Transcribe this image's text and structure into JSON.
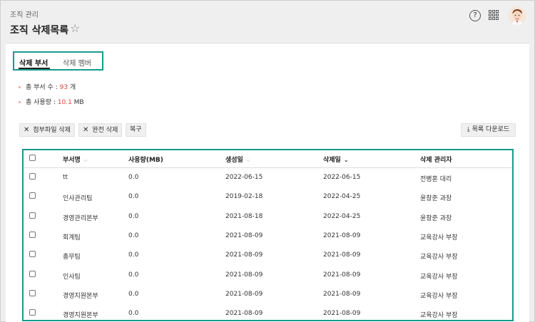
{
  "breadcrumb": "조직 관리",
  "page_title": "조직 삭제목록",
  "tabs": [
    {
      "label": "삭제 부서",
      "active": true
    },
    {
      "label": "삭제 멤버",
      "active": false
    }
  ],
  "stats": {
    "dept_count_label": "총 부서 수 : ",
    "dept_count_value": "93",
    "dept_count_unit": " 개",
    "usage_label": "총 사용량 : ",
    "usage_value": "10.1",
    "usage_unit": " MB"
  },
  "toolbar": {
    "delete_attachments": "첨부파일 삭제",
    "delete_complete": "완전 삭제",
    "restore": "복구",
    "download_list": "목록 다운로드"
  },
  "table": {
    "headers": {
      "dept": "부서명",
      "usage": "사용량(MB)",
      "created": "생성일",
      "deleted": "삭제일",
      "manager": "삭제 관리자"
    },
    "rows": [
      {
        "dept": "tt",
        "usage": "0.0",
        "created": "2022-06-15",
        "deleted": "2022-06-15",
        "manager": "전병훈 대리"
      },
      {
        "dept": "인사관리팀",
        "usage": "0.0",
        "created": "2019-02-18",
        "deleted": "2022-04-25",
        "manager": "윤창준 과장"
      },
      {
        "dept": "경영관리본부",
        "usage": "0.0",
        "created": "2021-08-18",
        "deleted": "2022-04-25",
        "manager": "윤창준 과장"
      },
      {
        "dept": "회계팀",
        "usage": "0.0",
        "created": "2021-08-09",
        "deleted": "2021-08-09",
        "manager": "교육강사 부장"
      },
      {
        "dept": "총무팀",
        "usage": "0.0",
        "created": "2021-08-09",
        "deleted": "2021-08-09",
        "manager": "교육강사 부장"
      },
      {
        "dept": "인사팀",
        "usage": "0.0",
        "created": "2021-08-09",
        "deleted": "2021-08-09",
        "manager": "교육강사 부장"
      },
      {
        "dept": "경영지원본부",
        "usage": "0.0",
        "created": "2021-08-09",
        "deleted": "2021-08-09",
        "manager": "교육강사 부장"
      },
      {
        "dept": "경영지원본부",
        "usage": "0.0",
        "created": "2021-08-09",
        "deleted": "2021-08-09",
        "manager": "교육강사 부장"
      }
    ]
  },
  "colors": {
    "accent": "#169b8e",
    "number": "#e0443a"
  }
}
